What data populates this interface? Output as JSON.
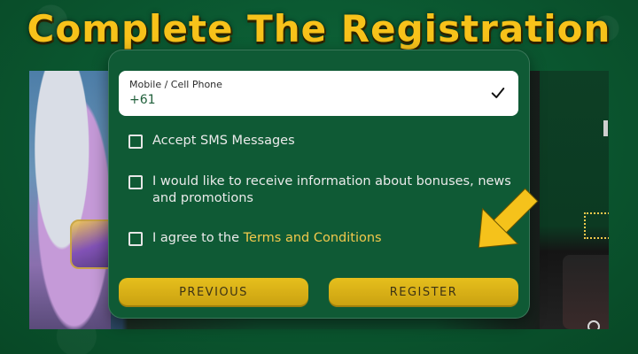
{
  "headline": "Complete The Registration",
  "form": {
    "phone_label": "Mobile / Cell Phone",
    "phone_value": "+61",
    "sms_label": "Accept SMS Messages",
    "bonus_label": "I would like to receive information about bonuses, news and promotions",
    "terms_prefix": "I agree to the ",
    "terms_link": "Terms and Conditions",
    "previous_label": "PREVIOUS",
    "register_label": "REGISTER"
  },
  "colors": {
    "accent": "#f2c94c",
    "panel": "#0f5a35",
    "button": "#e6bf1d"
  },
  "icons": {
    "field_valid": "check-icon",
    "pointer": "arrow-icon"
  }
}
